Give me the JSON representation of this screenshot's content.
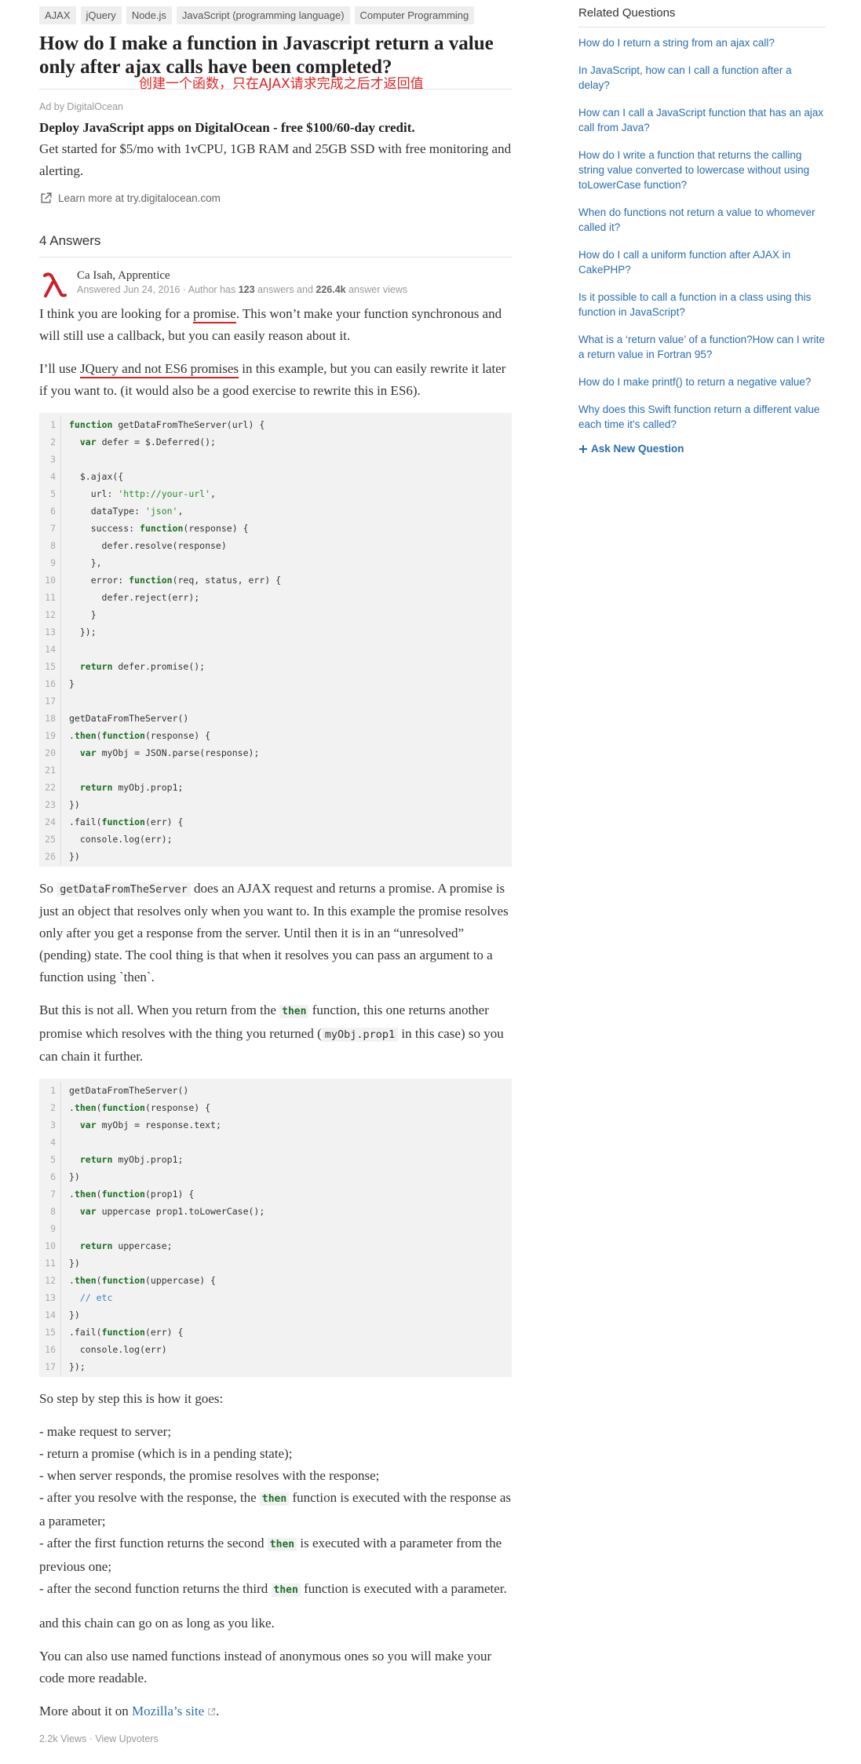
{
  "topics": [
    "AJAX",
    "jQuery",
    "Node.js",
    "JavaScript (programming language)",
    "Computer Programming"
  ],
  "question": {
    "title": "How do I make a function in Javascript return a value only after ajax calls have been completed?",
    "annotation": "创建一个函数，只在AJAX请求完成之后才返回值"
  },
  "ad": {
    "by": "Ad by DigitalOcean",
    "headline": "Deploy JavaScript apps on DigitalOcean - free $100/60-day credit.",
    "body": "Get started for $5/mo with 1vCPU, 1GB RAM and 25GB SSD with free monitoring and alerting.",
    "link": "Learn more at try.digitalocean.com"
  },
  "answers_header": "4 Answers",
  "answer": {
    "author": {
      "name": "Ca Isah, Apprentice",
      "answered": "Answered Jun 24, 2016",
      "sep": " · Author has ",
      "answers_count": "123",
      "mid": " answers and ",
      "views_count": "226.4k",
      "tail": " answer views"
    },
    "p1": {
      "before": "I think you are looking for a ",
      "link": "promise",
      "after": ". This won’t make your function synchronous and will still use a callback, but you can easily reason about it."
    },
    "p2": {
      "before": "I’ll use ",
      "highlight": "JQuery and not ES6 promises",
      "after": " in this example, but you can easily rewrite it later if you want to. (it would also be a good exercise to rewrite this in ES6)."
    },
    "p3": {
      "before": "So ",
      "code": "getDataFromTheServer",
      "after": " does an AJAX request and returns a promise. A promise is just an object that resolves only when you want to. In this example the promise resolves only after you get a response from the server. Until then it is in an “unresolved” (pending) state. The cool thing is that when it resolves you can pass an argument to a function using `then`."
    },
    "p4": {
      "before": "But this is not all. When you return from the ",
      "kw": "then",
      "middle": " function, this one returns another promise which resolves with the thing you returned (",
      "code": "myObj.prop1",
      "after": " in this case) so you can chain it further."
    },
    "p5": "So step by step this is how it goes:",
    "steps": {
      "s1": "- make request to server;",
      "s2": "- return a promise (which is in a pending state);",
      "s3": "- when server responds, the promise resolves with the response;",
      "s4a": "- after you resolve with the response, the ",
      "s4b": " function is executed with the response as a parameter;",
      "s5a": "- after the first function returns the second ",
      "s5b": " is executed with a parameter from the previous one;",
      "s6a": "- after the second function returns the third ",
      "s6b": " function is executed with a parameter.",
      "kw": "then"
    },
    "p6": "and this chain can go on as long as you like.",
    "p7": "You can also use named functions instead of anonymous ones so you will make your code more readable.",
    "p8": {
      "before": "More about it on ",
      "link": "Mozilla’s site",
      "after": "."
    },
    "footer": "2.2k Views · View Upvoters"
  },
  "code1": [
    [
      [
        "kw",
        "function"
      ],
      [
        "t",
        " getDataFromTheServer(url) {"
      ]
    ],
    [
      [
        "t",
        "  "
      ],
      [
        "kw",
        "var"
      ],
      [
        "t",
        " defer = $.Deferred();"
      ]
    ],
    [
      [
        "t",
        ""
      ]
    ],
    [
      [
        "t",
        "  $.ajax({"
      ]
    ],
    [
      [
        "t",
        "    url: "
      ],
      [
        "str",
        "'http://your-url'"
      ],
      [
        "t",
        ","
      ]
    ],
    [
      [
        "t",
        "    dataType: "
      ],
      [
        "str",
        "'json'"
      ],
      [
        "t",
        ","
      ]
    ],
    [
      [
        "t",
        "    success: "
      ],
      [
        "kw",
        "function"
      ],
      [
        "t",
        "(response) {"
      ]
    ],
    [
      [
        "t",
        "      defer.resolve(response)"
      ]
    ],
    [
      [
        "t",
        "    },"
      ]
    ],
    [
      [
        "t",
        "    error: "
      ],
      [
        "kw",
        "function"
      ],
      [
        "t",
        "(req, status, err) {"
      ]
    ],
    [
      [
        "t",
        "      defer.reject(err);"
      ]
    ],
    [
      [
        "t",
        "    }"
      ]
    ],
    [
      [
        "t",
        "  });"
      ]
    ],
    [
      [
        "t",
        ""
      ]
    ],
    [
      [
        "t",
        "  "
      ],
      [
        "kw",
        "return"
      ],
      [
        "t",
        " defer.promise();"
      ]
    ],
    [
      [
        "t",
        "}"
      ]
    ],
    [
      [
        "t",
        ""
      ]
    ],
    [
      [
        "t",
        "getDataFromTheServer()"
      ]
    ],
    [
      [
        "t",
        "."
      ],
      [
        "kw",
        "then"
      ],
      [
        "t",
        "("
      ],
      [
        "kw",
        "function"
      ],
      [
        "t",
        "(response) {"
      ]
    ],
    [
      [
        "t",
        "  "
      ],
      [
        "kw",
        "var"
      ],
      [
        "t",
        " myObj = JSON.parse(response);"
      ]
    ],
    [
      [
        "t",
        ""
      ]
    ],
    [
      [
        "t",
        "  "
      ],
      [
        "kw",
        "return"
      ],
      [
        "t",
        " myObj.prop1;"
      ]
    ],
    [
      [
        "t",
        "})"
      ]
    ],
    [
      [
        "t",
        ".fail("
      ],
      [
        "kw",
        "function"
      ],
      [
        "t",
        "(err) {"
      ]
    ],
    [
      [
        "t",
        "  console.log(err);"
      ]
    ],
    [
      [
        "t",
        "})"
      ]
    ]
  ],
  "code2": [
    [
      [
        "t",
        "getDataFromTheServer()"
      ]
    ],
    [
      [
        "t",
        "."
      ],
      [
        "kw",
        "then"
      ],
      [
        "t",
        "("
      ],
      [
        "kw",
        "function"
      ],
      [
        "t",
        "(response) {"
      ]
    ],
    [
      [
        "t",
        "  "
      ],
      [
        "kw",
        "var"
      ],
      [
        "t",
        " myObj = response.text;"
      ]
    ],
    [
      [
        "t",
        ""
      ]
    ],
    [
      [
        "t",
        "  "
      ],
      [
        "kw",
        "return"
      ],
      [
        "t",
        " myObj.prop1;"
      ]
    ],
    [
      [
        "t",
        "})"
      ]
    ],
    [
      [
        "t",
        "."
      ],
      [
        "kw",
        "then"
      ],
      [
        "t",
        "("
      ],
      [
        "kw",
        "function"
      ],
      [
        "t",
        "(prop1) {"
      ]
    ],
    [
      [
        "t",
        "  "
      ],
      [
        "kw",
        "var"
      ],
      [
        "t",
        " uppercase prop1.toLowerCase();"
      ]
    ],
    [
      [
        "t",
        ""
      ]
    ],
    [
      [
        "t",
        "  "
      ],
      [
        "kw",
        "return"
      ],
      [
        "t",
        " uppercase;"
      ]
    ],
    [
      [
        "t",
        "})"
      ]
    ],
    [
      [
        "t",
        "."
      ],
      [
        "kw",
        "then"
      ],
      [
        "t",
        "("
      ],
      [
        "kw",
        "function"
      ],
      [
        "t",
        "(uppercase) {"
      ]
    ],
    [
      [
        "t",
        "  "
      ],
      [
        "cm",
        "// etc"
      ]
    ],
    [
      [
        "t",
        "})"
      ]
    ],
    [
      [
        "t",
        ".fail("
      ],
      [
        "kw",
        "function"
      ],
      [
        "t",
        "(err) {"
      ]
    ],
    [
      [
        "t",
        "  console.log(err)"
      ]
    ],
    [
      [
        "t",
        "});"
      ]
    ]
  ],
  "sidebar": {
    "title": "Related Questions",
    "items": [
      "How do I return a string from an ajax call?",
      "In JavaScript, how can I call a function after a delay?",
      "How can I call a JavaScript function that has an ajax call from Java?",
      "How do I write a function that returns the calling string value converted to lowercase without using toLowerCase function?",
      "When do functions not return a value to whomever called it?",
      "How do I call a uniform function after AJAX in CakePHP?",
      "Is it possible to call a function in a class using this function in JavaScript?",
      "What is a ‘return value’ of a function?How can I write a return value in Fortran 95?",
      "How do I make printf() to return a negative value?",
      "Why does this Swift function return a different value each time it's called?"
    ],
    "ask_new": "Ask New Question"
  },
  "colors": {
    "link": "#2b6dad",
    "annotation": "#e02424",
    "keyword": "#1a6d23"
  }
}
